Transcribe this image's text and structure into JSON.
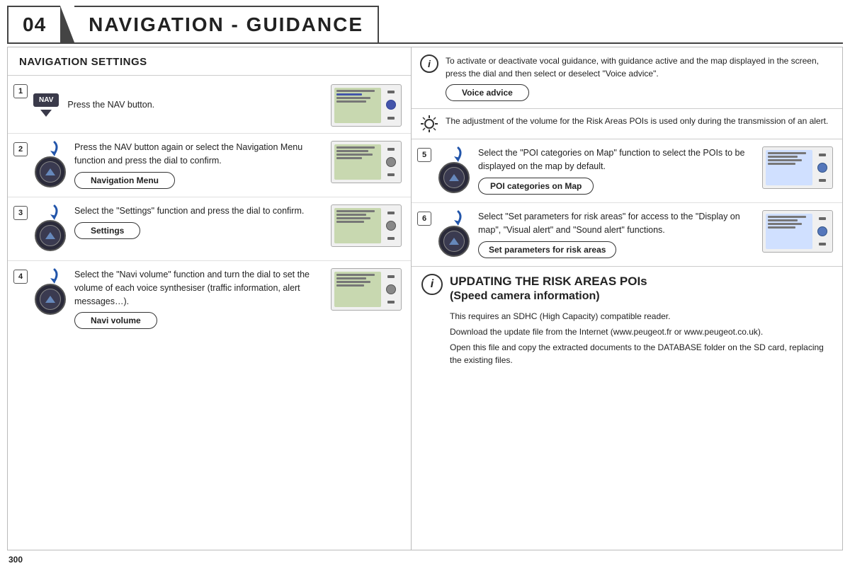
{
  "header": {
    "chapter": "04",
    "title": "NAVIGATION - GUIDANCE"
  },
  "left": {
    "section_title": "NAVIGATION SETTINGS",
    "steps": [
      {
        "number": "1",
        "text": "Press the NAV button.",
        "has_nav_icon": true,
        "has_dial": false,
        "btn_label": null
      },
      {
        "number": "2",
        "text": "Press the NAV button again or select the Navigation Menu function and press the dial to confirm.",
        "has_nav_icon": false,
        "has_dial": true,
        "btn_label": "Navigation Menu"
      },
      {
        "number": "3",
        "text": "Select the \"Settings\" function and press the dial to confirm.",
        "has_nav_icon": false,
        "has_dial": true,
        "btn_label": "Settings"
      },
      {
        "number": "4",
        "text": "Select the \"Navi volume\" function and turn the dial to set the volume of each voice synthesiser (traffic information, alert messages…).",
        "has_nav_icon": false,
        "has_dial": true,
        "btn_label": "Navi volume"
      }
    ]
  },
  "right": {
    "info_top": {
      "text": "To activate or deactivate vocal guidance, with guidance active and the map displayed in the screen, press the dial and then select or deselect \"Voice advice\".",
      "btn_label": "Voice advice"
    },
    "alert_text": "The adjustment of the volume for the Risk Areas POIs is used only during the transmission of an alert.",
    "steps": [
      {
        "number": "5",
        "text": "Select the \"POI categories on Map\" function to select the POIs to be displayed on the map by default.",
        "btn_label": "POI categories on Map"
      },
      {
        "number": "6",
        "text": "Select \"Set parameters for risk areas\" for access to the \"Display on map\", \"Visual alert\" and \"Sound alert\" functions.",
        "btn_label": "Set parameters for risk areas"
      }
    ],
    "updating": {
      "title_line1": "UPDATING THE RISK AREAS POIs",
      "title_line2": "(Speed camera information)",
      "paragraphs": [
        "This requires an SDHC (High Capacity) compatible reader.",
        "Download the update file from the Internet (www.peugeot.fr or www.peugeot.co.uk).",
        "Open this file and copy the extracted documents to the DATABASE folder on the SD card, replacing the existing files."
      ]
    }
  },
  "page_number": "300"
}
